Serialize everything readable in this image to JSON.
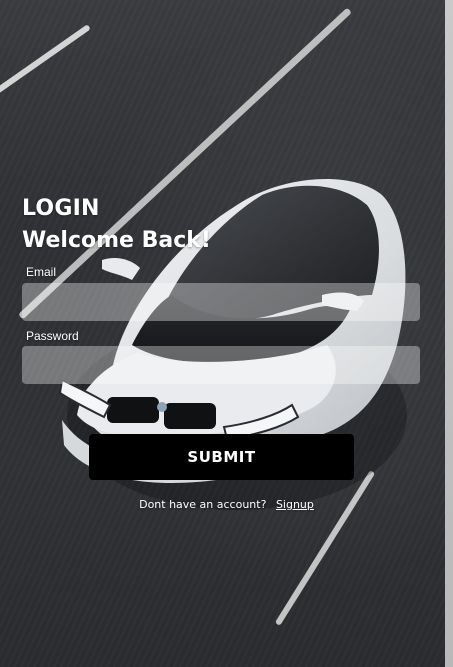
{
  "colors": {
    "text": "#ffffff",
    "button_bg": "#000000",
    "input_bg": "rgba(255,255,255,0.35)",
    "road": "#303236"
  },
  "header": {
    "title": "LOGIN",
    "subtitle": "Welcome Back!"
  },
  "form": {
    "email_label": "Email",
    "email_value": "",
    "email_placeholder": "",
    "password_label": "Password",
    "password_value": "",
    "password_placeholder": "",
    "submit_label": "SUBMIT"
  },
  "footer": {
    "prompt": "Dont have an account?",
    "signup_label": "Signup"
  },
  "background": {
    "image": "car-on-road"
  }
}
